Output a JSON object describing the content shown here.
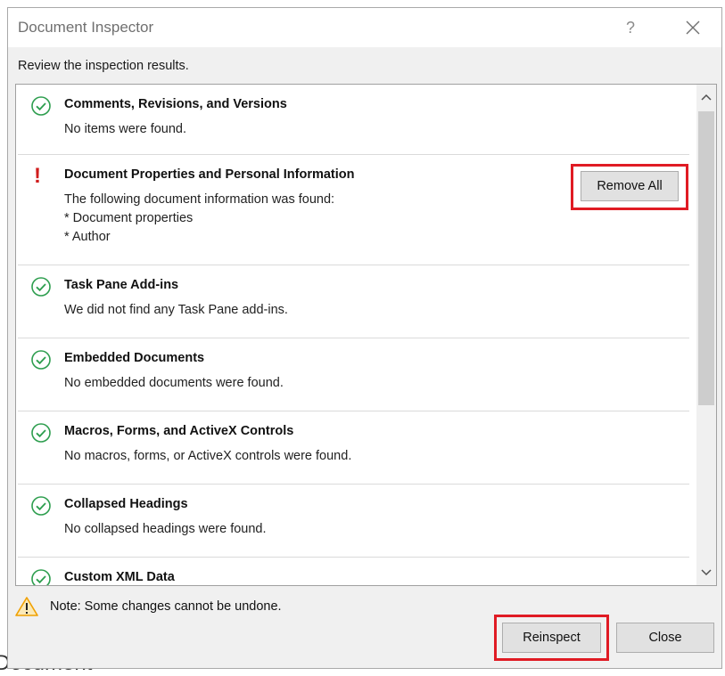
{
  "dialog": {
    "title": "Document Inspector",
    "help_label": "?",
    "subtitle": "Review the inspection results."
  },
  "results": [
    {
      "status": "ok",
      "title": "Comments, Revisions, and Versions",
      "description": [
        "No items were found."
      ]
    },
    {
      "status": "warning",
      "title": "Document Properties and Personal Information",
      "description": [
        "The following document information was found:",
        "* Document properties",
        "* Author"
      ],
      "action_label": "Remove All"
    },
    {
      "status": "ok",
      "title": "Task Pane Add-ins",
      "description": [
        "We did not find any Task Pane add-ins."
      ]
    },
    {
      "status": "ok",
      "title": "Embedded Documents",
      "description": [
        "No embedded documents were found."
      ]
    },
    {
      "status": "ok",
      "title": "Macros, Forms, and ActiveX Controls",
      "description": [
        "No macros, forms, or ActiveX controls were found."
      ]
    },
    {
      "status": "ok",
      "title": "Collapsed Headings",
      "description": [
        "No collapsed headings were found."
      ]
    },
    {
      "status": "ok",
      "title": "Custom XML Data",
      "description": []
    }
  ],
  "footer": {
    "note": "Note: Some changes cannot be undone.",
    "reinspect_label": "Reinspect",
    "close_label": "Close"
  },
  "background": {
    "partial_text": "Document"
  },
  "colors": {
    "ok_green": "#2e9e4f",
    "warning_red": "#d01c1c",
    "highlight_red": "#e01b24",
    "warning_triangle": "#f0a000"
  },
  "icons": {
    "ok": "check-circle-icon",
    "warning": "exclamation-icon",
    "note": "warning-triangle-icon",
    "close": "close-icon",
    "help": "help-icon"
  }
}
